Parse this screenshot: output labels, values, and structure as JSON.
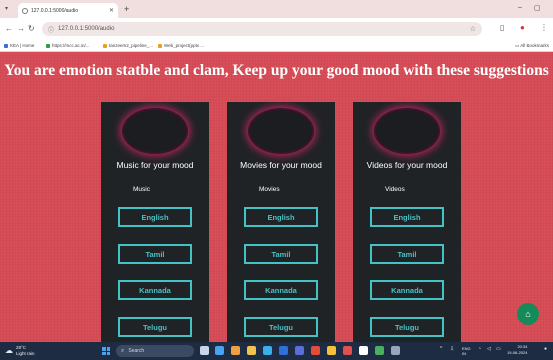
{
  "browser": {
    "tab_title": "127.0.0.1:5000/audio",
    "url": "127.0.0.1:5000/audio",
    "bookmarks": [
      {
        "label": "KEA | Home",
        "color": "#3d6bd6"
      },
      {
        "label": "https://mcc.ac.in/...",
        "color": "#2f9a4a"
      },
      {
        "label": "tanzeem2_pipeline_...",
        "color": "#e8a020"
      },
      {
        "label": "Web_project(pptx ...",
        "color": "#e8a020"
      }
    ],
    "all_bookmarks": "All Bookmarks"
  },
  "page": {
    "headline": "You are emotion statble and clam, Keep up your good mood with these suggestions"
  },
  "cards": [
    {
      "title": "Music for your mood",
      "subtitle": "Music",
      "options": [
        "English",
        "Tamil",
        "Kannada",
        "Telugu"
      ]
    },
    {
      "title": "Movies for your mood",
      "subtitle": "Movies",
      "options": [
        "English",
        "Tamil",
        "Kannada",
        "Telugu"
      ]
    },
    {
      "title": "Videos for your mood",
      "subtitle": "Videos",
      "options": [
        "English",
        "Tamil",
        "Kannada",
        "Telugu"
      ]
    }
  ],
  "taskbar": {
    "weather_temp": "28°C",
    "weather_desc": "Light rain",
    "search_label": "Search",
    "lang": "ENG",
    "lang_sub": "IN",
    "time": "20:34",
    "date": "19-06-2024"
  },
  "colors": {
    "page_bg": "#d64b55",
    "card_bg": "#202326",
    "accent": "#45c2c6",
    "glow": "#e6286e",
    "fab": "#178a5a"
  }
}
